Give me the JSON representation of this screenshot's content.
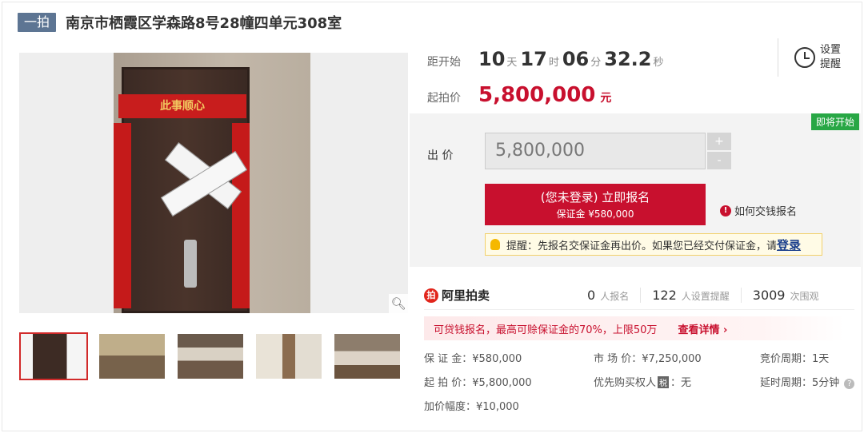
{
  "header": {
    "badge": "一拍",
    "title": "南京市栖霞区学森路8号28幢四单元308室"
  },
  "gallery": {
    "main_image_alt": "sealed door with couplets",
    "couplet_top_text": "此事顺心",
    "zoom_icon": "search-icon",
    "thumbnails": 5,
    "active_index": 0
  },
  "countdown": {
    "label": "距开始",
    "days": "10",
    "days_unit": "天",
    "hours": "17",
    "hours_unit": "时",
    "minutes": "06",
    "minutes_unit": "分",
    "seconds": "32.2",
    "seconds_unit": "秒"
  },
  "reminder": {
    "line1": "设置",
    "line2": "提醒",
    "icon": "alarm-clock-icon"
  },
  "start_price": {
    "label": "起拍价",
    "value": "5,800,000",
    "unit": "元"
  },
  "bid": {
    "status_badge": "即将开始",
    "label": "出 价",
    "input_value": "5,800,000",
    "plus": "+",
    "minus": "-",
    "signup_line1": "(您未登录) 立即报名",
    "signup_line2": "保证金 ¥580,000",
    "how_to": "如何交钱报名",
    "tip_text": "提醒：先报名交保证金再出价。如果您已经交付保证金，请",
    "tip_login": "登录"
  },
  "stats": {
    "brand": "阿里拍卖",
    "signups": "0",
    "signups_label": "人报名",
    "reminders": "122",
    "reminders_label": "人设置提醒",
    "views": "3009",
    "views_label": "次围观"
  },
  "promo": {
    "text": "可贷钱报名，最高可赊保证金的70%，上限50万",
    "detail": "查看详情 ›"
  },
  "details": {
    "deposit": "保 证 金：¥580,000",
    "market_price": "市 场 价：¥7,250,000",
    "bid_period": "竞价周期：1天",
    "start_price": "起 拍 价：¥5,800,000",
    "priority_label": "优先购买权人",
    "priority_tag": "税",
    "priority_value": "：无",
    "delay_period": "延时周期：5分钟",
    "increment": "加价幅度：¥10,000"
  }
}
